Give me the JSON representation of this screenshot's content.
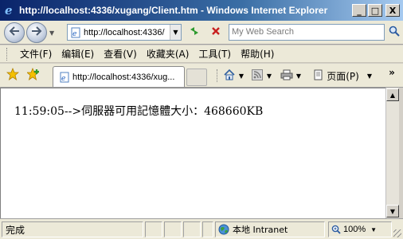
{
  "window": {
    "title": "http://localhost:4336/xugang/Client.htm - Windows Internet Explorer",
    "buttons": {
      "minimize": "_",
      "maximize": "□",
      "close": "X"
    }
  },
  "address_bar": {
    "url": "http://localhost:4336/",
    "search_placeholder": "My Web Search"
  },
  "menu": {
    "items": [
      "文件(F)",
      "编辑(E)",
      "查看(V)",
      "收藏夹(A)",
      "工具(T)",
      "帮助(H)"
    ]
  },
  "tab": {
    "title": "http://localhost:4336/xug..."
  },
  "toolbar": {
    "page_label": "页面(P)"
  },
  "content": {
    "line": "11:59:05-->伺服器可用記憶體大小：468660KB"
  },
  "status": {
    "text": "完成",
    "zone": "本地 Intranet",
    "zoom": "100%"
  },
  "icons": {
    "title": "ie-icon",
    "back": "back-arrow-icon",
    "forward": "forward-arrow-icon",
    "refresh": "refresh-icon",
    "stop": "stop-icon",
    "search": "search-icon",
    "favorites": "star-icon",
    "add_favorites": "add-favorite-icon",
    "home": "home-icon",
    "feeds": "rss-icon",
    "print": "print-icon",
    "page": "page-icon",
    "zone": "globe-icon",
    "zoom": "zoom-icon"
  }
}
